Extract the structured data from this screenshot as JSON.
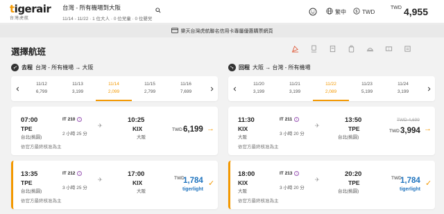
{
  "header": {
    "logo_main": "tigerair",
    "logo_sub": "台灣虎航",
    "search_title": "台灣 - 所有機場到大阪",
    "search_sub": "11/14 - 11/22 · 1 位大人 · 0 位兒童 · 0 位嬰兒",
    "language": "繁中",
    "currency": "TWD",
    "total_currency": "TWD",
    "total_amount": "4,955"
  },
  "banner": {
    "text": "樂天台灣虎航聯名信用卡專屬優惠購票網頁"
  },
  "page_title": "選擇航班",
  "outbound": {
    "label": "去程",
    "route": "台灣 - 所有機場 → 大阪",
    "dates": [
      {
        "date": "11/12",
        "price": "6,799"
      },
      {
        "date": "11/13",
        "price": "3,199"
      },
      {
        "date": "11/14",
        "price": "2,099"
      },
      {
        "date": "11/15",
        "price": "2,799"
      },
      {
        "date": "11/16",
        "price": "7,699"
      }
    ],
    "selected_index": 2,
    "flights": [
      {
        "dep_time": "07:00",
        "dep_code": "TPE",
        "dep_city": "台北(桃園)",
        "flight_no": "IT 210",
        "duration": "2 小時 25 分",
        "arr_time": "10:25",
        "arr_code": "KIX",
        "arr_city": "大阪",
        "note": "依官方最終核准為主",
        "currency": "TWD",
        "price": "6,199",
        "old_price": "",
        "fare": "",
        "selected": false
      },
      {
        "dep_time": "13:35",
        "dep_code": "TPE",
        "dep_city": "台北(桃園)",
        "flight_no": "IT 212",
        "duration": "3 小時 25 分",
        "arr_time": "17:00",
        "arr_code": "KIX",
        "arr_city": "大阪",
        "note": "依官方最終核准為主",
        "currency": "TWD",
        "price": "1,784",
        "old_price": "",
        "fare": "tigerlight",
        "selected": true
      }
    ]
  },
  "inbound": {
    "label": "回程",
    "route": "大阪 → 台灣 - 所有機場",
    "dates": [
      {
        "date": "11/20",
        "price": "3,199"
      },
      {
        "date": "11/21",
        "price": "3,199"
      },
      {
        "date": "11/22",
        "price": "2,089"
      },
      {
        "date": "11/23",
        "price": "5,199"
      },
      {
        "date": "11/24",
        "price": "3,199"
      }
    ],
    "selected_index": 2,
    "flights": [
      {
        "dep_time": "11:30",
        "dep_code": "KIX",
        "dep_city": "大阪",
        "flight_no": "IT 211",
        "duration": "3 小時 20 分",
        "arr_time": "13:50",
        "arr_code": "TPE",
        "arr_city": "台北(桃園)",
        "note": "依官方最終核准為主",
        "currency": "TWD",
        "price": "3,994",
        "old_price": "TWD 4,699",
        "fare": "",
        "selected": false
      },
      {
        "dep_time": "18:00",
        "dep_code": "KIX",
        "dep_city": "大阪",
        "flight_no": "IT 213",
        "duration": "3 小時 20 分",
        "arr_time": "20:20",
        "arr_code": "TPE",
        "arr_city": "台北(桃園)",
        "note": "依官方最終核准為主",
        "currency": "TWD",
        "price": "1,784",
        "old_price": "",
        "fare": "tigerlight",
        "selected": true
      }
    ]
  },
  "colors": {
    "accent": "#f39800",
    "blue": "#1e73be",
    "info": "#9b59b6"
  }
}
